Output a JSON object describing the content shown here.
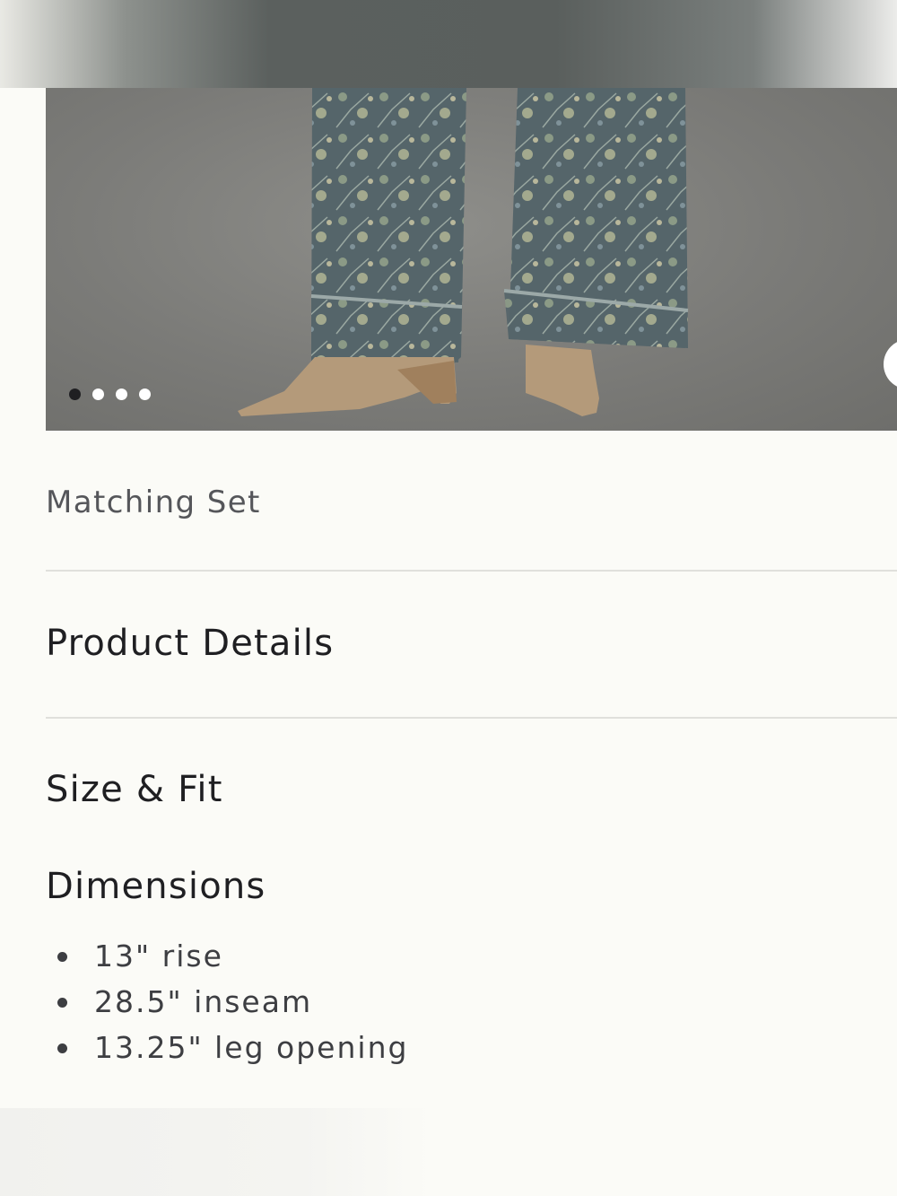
{
  "carousel": {
    "dot_count": 4,
    "active_index": 0
  },
  "product": {
    "collection_label": "Matching Set"
  },
  "sections": {
    "product_details": "Product Details",
    "size_fit": "Size & Fit",
    "dimensions_heading": "Dimensions",
    "dimensions": [
      "13\" rise",
      "28.5\" inseam",
      "13.25\" leg opening"
    ]
  },
  "colors": {
    "background": "#fbfbf7",
    "text": "#1f1f22",
    "muted_text": "#55565a",
    "divider": "#e0e0dc"
  }
}
